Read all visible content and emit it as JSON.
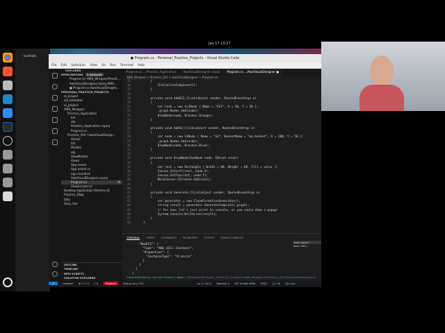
{
  "system": {
    "clock": "Jan 17  13:27",
    "behind_tab": "localhost"
  },
  "window": {
    "title": "● Program.cs - Personal_Practice_Projects - Visual Studio Code"
  },
  "menu": [
    "File",
    "Edit",
    "Selection",
    "View",
    "Go",
    "Run",
    "Terminal",
    "Help"
  ],
  "sidebar": {
    "header": "EXPLORER",
    "open_editors": {
      "label": "OPEN EDITORS",
      "badge": "1 unsaved",
      "items": [
        "Program.cs  AWS_Wrapper/Practic...",
        "AwsVisualDesigner.csproj  AWS...",
        "● Program.cs  AwsVisualDesigne..."
      ]
    },
    "project": {
      "label": "PERSONAL_PRACTICE_PROJECTS",
      "items": [
        {
          "label": "ai_project",
          "depth": 0
        },
        {
          "label": "ad_simulator",
          "depth": 0
        },
        {
          "label": "ai_project",
          "depth": 0
        },
        {
          "label": "AWS_Wrapper",
          "depth": 0
        },
        {
          "label": "Practice_Application",
          "depth": 1
        },
        {
          "label": "bin",
          "depth": 2
        },
        {
          "label": "obj",
          "depth": 2
        },
        {
          "label": "Practice_Application.csproj",
          "depth": 2
        },
        {
          "label": "Program.cs",
          "depth": 2
        },
        {
          "label": "Practice_GUI / AwsVisualDesign...",
          "depth": 1
        },
        {
          "label": "Assets",
          "depth": 2
        },
        {
          "label": "bin",
          "depth": 2
        },
        {
          "label": "Models",
          "depth": 2
        },
        {
          "label": "obj",
          "depth": 2
        },
        {
          "label": "ViewModels",
          "depth": 2
        },
        {
          "label": "Views",
          "depth": 2
        },
        {
          "label": "App.axaml",
          "depth": 2
        },
        {
          "label": "App.axaml.cs",
          "depth": 2
        },
        {
          "label": "app.manifest",
          "depth": 2
        },
        {
          "label": "AwsVisualDesigner.csproj",
          "depth": 2
        },
        {
          "label": "Program.cs",
          "depth": 2,
          "selected": true,
          "badge": "M"
        },
        {
          "label": "ViewLocator.cs",
          "depth": 2
        },
        {
          "label": "Desktop Application Electron JS",
          "depth": 0
        },
        {
          "label": "Practice_Blog",
          "depth": 0
        },
        {
          "label": "tally",
          "depth": 0
        },
        {
          "label": "Suzy_Vue",
          "depth": 0
        }
      ]
    },
    "sections": [
      "OUTLINE",
      "TIMELINE",
      "NPM SCRIPTS",
      "SOLUTION EXPLORER"
    ]
  },
  "tabs": [
    {
      "label": "Program.cs  .../Practice_Application",
      "active": false
    },
    {
      "label": "AwsVisualDesigner.csproj",
      "active": false
    },
    {
      "label": "Program.cs  .../AwsVisualDesigner ●",
      "active": true
    }
  ],
  "breadcrumb": "AWS_Wrapper > Practice_GUI > AwsVisualDesigner > Program.cs",
  "code": [
    {
      "n": "15",
      "t": "    {"
    },
    {
      "n": "16",
      "t": "        InitializeComponent();"
    },
    {
      "n": "17",
      "t": "    }"
    },
    {
      "n": "18",
      "t": ""
    },
    {
      "n": "19",
      "t": "    private void AddEC2_Click(object sender, RoutedEventArgs e)"
    },
    {
      "n": "20",
      "t": "    {"
    },
    {
      "n": "21",
      "t": "        var node = new Ec2Node { Name = \"EC2\", X = 50, Y = 50 };"
    },
    {
      "n": "22",
      "t": "        _graph.Nodes.Add(node);"
    },
    {
      "n": "23",
      "t": "        DrawNode(node, Brushes.Orange);"
    },
    {
      "n": "24",
      "t": "    }"
    },
    {
      "n": "25",
      "t": ""
    },
    {
      "n": "26",
      "t": "    private void AddS3_Click(object sender, RoutedEventArgs e)"
    },
    {
      "n": "27",
      "t": "    {"
    },
    {
      "n": "28",
      "t": "        var node = new S3Node { Name = \"S3\", BucketName = \"my-bucket\", X = 200, Y = 50 };"
    },
    {
      "n": "29",
      "t": "        _graph.Nodes.Add(node);"
    },
    {
      "n": "30",
      "t": "        DrawNode(node, Brushes.Blue);"
    },
    {
      "n": "31",
      "t": "    }"
    },
    {
      "n": "32",
      "t": ""
    },
    {
      "n": "33",
      "t": "    private void DrawNode(AwsNode node, IBrush color)"
    },
    {
      "n": "34",
      "t": "    {"
    },
    {
      "n": "35",
      "t": "        var rect = new Rectangle { Width = 80, Height = 60, Fill = color };"
    },
    {
      "n": "36",
      "t": "        Canvas.SetLeft(rect, node.X);"
    },
    {
      "n": "37",
      "t": "        Canvas.SetTop(rect, node.Y);"
    },
    {
      "n": "38",
      "t": "        MainCanvas.Children.Add(rect);"
    },
    {
      "n": "39",
      "t": "    }"
    },
    {
      "n": "40",
      "t": ""
    },
    {
      "n": "41",
      "t": "    private void Generate_Click(object sender, RoutedEventArgs e)"
    },
    {
      "n": "42",
      "t": "    {"
    },
    {
      "n": "43",
      "t": "        var generator = new CloudFormationGenerator();"
    },
    {
      "n": "44",
      "t": "        string result = generator.GenerateTemplate(_graph);"
    },
    {
      "n": "45",
      "t": "        // For now, let's just print to console, or you could show a popup!"
    },
    {
      "n": "46",
      "t": "        System.Console.WriteLine(result);"
    },
    {
      "n": "47",
      "t": "    }"
    },
    {
      "n": "48",
      "t": "}"
    }
  ],
  "panel": {
    "tabs": [
      "TERMINAL",
      "PORTS",
      "COMMENTS",
      "PROBLEMS",
      "OUTPUT",
      "DEBUG CONSOLE"
    ],
    "terminal_lines": [
      "    \"NewEC2\": {",
      "      \"Type\": \"AWS::EC2::Instance\",",
      "      \"Properties\": {",
      "        \"InstanceType\": \"t2.micro\"",
      "      }",
      "    }",
      "  }",
      "}"
    ],
    "prompt_user": "timothy@timothy-System-Product-Name",
    "prompt_path": ":~/Desktop/Personal_Practice_Projects/AWS_Wrapper/Practice_GUI/AwsVisualDesigner$",
    "terminals": [
      "bash  AwsVi...",
      "bash  AWS_..."
    ]
  },
  "status": {
    "branch": "master*",
    "errors": "⊗ 0 ⚠ 0",
    "ports": "⚡ 0",
    "project": "Projects",
    "debug": "Debug Any CPU",
    "position": "Ln 1, Col 1",
    "spaces": "Spaces: 4",
    "encoding": "UTF-8 with BOM",
    "eol": "CRLF",
    "language": "{} C#",
    "golive": "Go Live"
  },
  "colors": {
    "accent": "#0078d4",
    "status_badge": "#c50f1f",
    "prompt_user": "#23d18b",
    "prompt_path": "#3b8eea"
  }
}
